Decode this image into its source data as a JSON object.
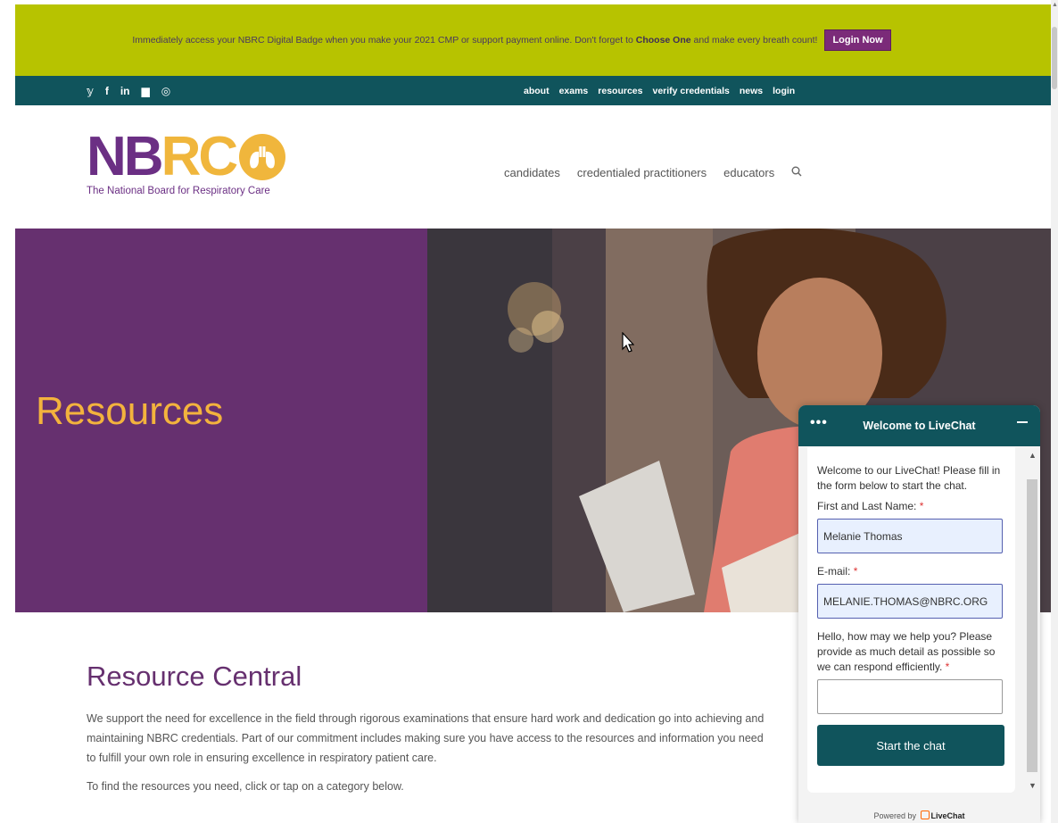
{
  "announcement": {
    "text_before": "Immediately access your NBRC Digital Badge when you make your 2021 CMP or support payment online. Don't forget to",
    "bold": "Choose One",
    "text_after": "and make every breath count!",
    "button": "Login Now"
  },
  "social_icons": [
    "twitter-icon",
    "facebook-icon",
    "linkedin-icon",
    "youtube-icon",
    "instagram-icon"
  ],
  "social_glyphs": [
    "𝕪",
    "f",
    "in",
    "▆",
    "◎"
  ],
  "top_nav": [
    "about",
    "exams",
    "resources",
    "verify credentials",
    "news",
    "login"
  ],
  "logo": {
    "word_a": "NB",
    "word_b": "RC",
    "subtitle": "The National Board for Respiratory Care"
  },
  "main_nav": [
    "candidates",
    "credentialed practitioners",
    "educators"
  ],
  "hero": {
    "title": "Resources"
  },
  "content": {
    "heading": "Resource Central",
    "paragraph1": "We support the need for excellence in the field through rigorous examinations that ensure hard work and dedication go into achieving and maintaining NBRC credentials. Part of our commitment includes making sure you have access to the resources and information you need to fulfill your own role in ensuring excellence in respiratory patient care.",
    "paragraph2": "To find the resources you need, click or tap on a category below."
  },
  "livechat": {
    "title": "Welcome to LiveChat",
    "dots": "•••",
    "intro": "Welcome to our LiveChat! Please fill in the form below to start the chat.",
    "name_label": "First and Last Name:",
    "name_value": "Melanie Thomas",
    "email_label": "E-mail:",
    "email_value": "MELANIE.THOMAS@NBRC.ORG",
    "help_label": "Hello, how may we help you? Please provide as much detail as possible so we can respond efficiently.",
    "help_value": "",
    "required_mark": "*",
    "button": "Start the chat",
    "powered_prefix": "Powered by",
    "powered_brand": "LiveChat"
  },
  "colors": {
    "announce_bg": "#b7c300",
    "nav_bg": "#10545c",
    "brand_purple": "#66306f",
    "brand_gold": "#f3b33d"
  }
}
